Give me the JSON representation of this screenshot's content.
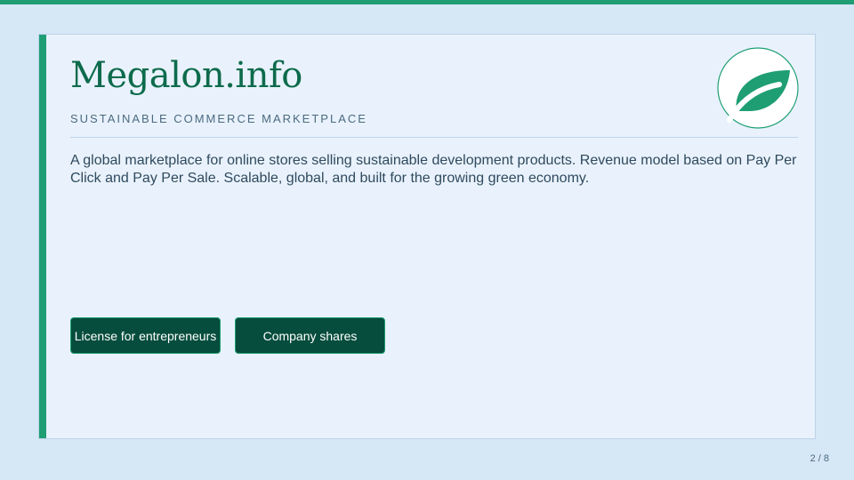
{
  "slide": {
    "title": "Megalon.info",
    "subtitle": "SUSTAINABLE COMMERCE MARKETPLACE",
    "description": "A global marketplace for online stores selling sustainable development products. Revenue model based on Pay Per Click and Pay Per Sale. Scalable, global, and built for the growing green economy.",
    "logo_icon": "leaf-icon"
  },
  "buttons": {
    "license_label": "License for entrepreneurs",
    "shares_label": "Company shares"
  },
  "pagination": {
    "label": "2 / 8"
  },
  "colors": {
    "accent": "#1f9e74",
    "button_bg": "#064d3d",
    "title": "#0d6b4c",
    "background": "#d6e7f6",
    "card": "#e9f2fc"
  }
}
